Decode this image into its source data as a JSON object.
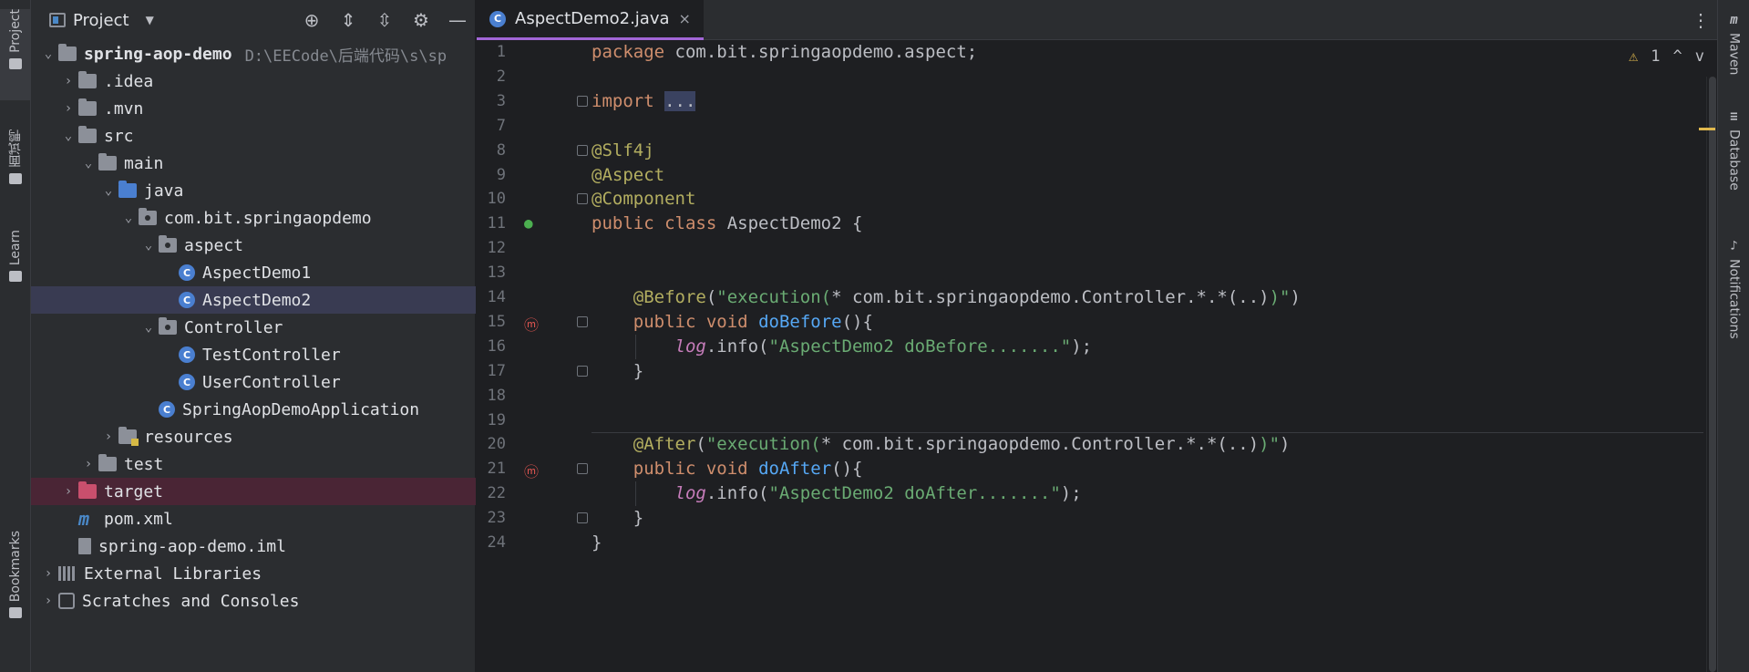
{
  "left_strip": {
    "tabs": [
      {
        "label": "Project",
        "icon": "folder-icon",
        "active": true
      },
      {
        "label": "面试鸭",
        "icon": "duck-icon",
        "active": false
      },
      {
        "label": "Learn",
        "icon": "graduation-cap-icon",
        "active": false
      },
      {
        "label": "Bookmarks",
        "icon": "bookmark-icon",
        "active": false
      }
    ]
  },
  "project_panel": {
    "title": "Project",
    "toolbar_icons": [
      "target-icon",
      "expand-all-icon",
      "collapse-all-icon",
      "gear-icon",
      "minimize-icon"
    ],
    "tree": [
      {
        "label": "spring-aop-demo",
        "path": "D:\\EECode\\后端代码\\s\\sp",
        "depth": 0,
        "expanded": true,
        "icon": "module-folder-icon",
        "bold": true
      },
      {
        "label": ".idea",
        "depth": 1,
        "expanded": false,
        "icon": "folder-icon"
      },
      {
        "label": ".mvn",
        "depth": 1,
        "expanded": false,
        "icon": "folder-icon"
      },
      {
        "label": "src",
        "depth": 1,
        "expanded": true,
        "icon": "folder-icon"
      },
      {
        "label": "main",
        "depth": 2,
        "expanded": true,
        "icon": "folder-icon"
      },
      {
        "label": "java",
        "depth": 3,
        "expanded": true,
        "icon": "source-folder-icon"
      },
      {
        "label": "com.bit.springaopdemo",
        "depth": 4,
        "expanded": true,
        "icon": "package-icon"
      },
      {
        "label": "aspect",
        "depth": 5,
        "expanded": true,
        "icon": "package-icon"
      },
      {
        "label": "AspectDemo1",
        "depth": 6,
        "icon": "class-icon"
      },
      {
        "label": "AspectDemo2",
        "depth": 6,
        "icon": "class-icon",
        "selected": true
      },
      {
        "label": "Controller",
        "depth": 5,
        "expanded": true,
        "icon": "package-icon"
      },
      {
        "label": "TestController",
        "depth": 6,
        "icon": "class-icon"
      },
      {
        "label": "UserController",
        "depth": 6,
        "icon": "class-icon"
      },
      {
        "label": "SpringAopDemoApplication",
        "depth": 5,
        "icon": "spring-boot-class-icon"
      },
      {
        "label": "resources",
        "depth": 3,
        "expanded": false,
        "icon": "resources-folder-icon"
      },
      {
        "label": "test",
        "depth": 2,
        "expanded": false,
        "icon": "folder-icon"
      },
      {
        "label": "target",
        "depth": 1,
        "expanded": false,
        "icon": "excluded-folder-icon",
        "excluded": true
      },
      {
        "label": "pom.xml",
        "depth": 1,
        "icon": "maven-icon"
      },
      {
        "label": "spring-aop-demo.iml",
        "depth": 1,
        "icon": "iml-file-icon"
      },
      {
        "label": "External Libraries",
        "depth": 0,
        "expanded": false,
        "icon": "libraries-icon"
      },
      {
        "label": "Scratches and Consoles",
        "depth": 0,
        "expanded": false,
        "icon": "scratches-icon"
      }
    ]
  },
  "editor": {
    "tab": {
      "title": "AspectDemo2.java",
      "icon": "class-icon",
      "close": "×"
    },
    "more_icon": "⋮",
    "inspections": {
      "warning_count": "1",
      "warning_icon": "warning-icon",
      "up": "^",
      "down": "v"
    },
    "lines": [
      {
        "no": "1",
        "tokens": [
          [
            "kw",
            "package"
          ],
          [
            "",
            " com.bit.springaopdemo.aspect;"
          ]
        ]
      },
      {
        "no": "2",
        "tokens": []
      },
      {
        "no": "3",
        "tokens": [
          [
            "kw",
            "import"
          ],
          [
            "",
            " "
          ],
          [
            "fold-hl",
            "..."
          ]
        ]
      },
      {
        "no": "7",
        "tokens": []
      },
      {
        "no": "8",
        "tokens": [
          [
            "ann",
            "@Slf4j"
          ]
        ]
      },
      {
        "no": "9",
        "tokens": [
          [
            "ann",
            "@Aspect"
          ]
        ]
      },
      {
        "no": "10",
        "tokens": [
          [
            "ann",
            "@Component"
          ]
        ]
      },
      {
        "no": "11",
        "tokens": [
          [
            "kw",
            "public class"
          ],
          [
            "",
            " AspectDemo2 {"
          ]
        ]
      },
      {
        "no": "12",
        "tokens": []
      },
      {
        "no": "13",
        "tokens": []
      },
      {
        "no": "14",
        "tokens": [
          [
            "",
            "    "
          ],
          [
            "ann",
            "@Before"
          ],
          [
            "",
            "("
          ],
          [
            "str",
            "\"execution("
          ],
          [
            "",
            "* com.bit.springaopdemo.Controller.*.*(..)"
          ],
          [
            "str",
            ")\""
          ],
          [
            "",
            ")"
          ]
        ]
      },
      {
        "no": "15",
        "tokens": [
          [
            "",
            "    "
          ],
          [
            "kw",
            "public void"
          ],
          [
            "",
            " "
          ],
          [
            "fn",
            "doBefore"
          ],
          [
            "",
            "(){"
          ]
        ]
      },
      {
        "no": "16",
        "tokens": [
          [
            "",
            "        "
          ],
          [
            "fld",
            "log"
          ],
          [
            "",
            ".info("
          ],
          [
            "str",
            "\"AspectDemo2 doBefore.......\""
          ],
          [
            "",
            ");"
          ]
        ]
      },
      {
        "no": "17",
        "tokens": [
          [
            "",
            "    }"
          ]
        ]
      },
      {
        "no": "18",
        "tokens": []
      },
      {
        "no": "19",
        "tokens": []
      },
      {
        "no": "20",
        "tokens": [
          [
            "",
            "    "
          ],
          [
            "ann",
            "@After"
          ],
          [
            "",
            "("
          ],
          [
            "str",
            "\"execution("
          ],
          [
            "",
            "* com.bit.springaopdemo.Controller.*.*(..)"
          ],
          [
            "str",
            ")\""
          ],
          [
            "",
            ")"
          ]
        ]
      },
      {
        "no": "21",
        "tokens": [
          [
            "",
            "    "
          ],
          [
            "kw",
            "public void"
          ],
          [
            "",
            " "
          ],
          [
            "fn",
            "doAfter"
          ],
          [
            "",
            "(){"
          ]
        ]
      },
      {
        "no": "22",
        "tokens": [
          [
            "",
            "        "
          ],
          [
            "fld",
            "log"
          ],
          [
            "",
            ".info("
          ],
          [
            "str",
            "\"AspectDemo2 doAfter.......\""
          ],
          [
            "",
            ");"
          ]
        ]
      },
      {
        "no": "23",
        "tokens": [
          [
            "",
            "    }"
          ]
        ]
      },
      {
        "no": "24",
        "tokens": [
          [
            "",
            "}"
          ]
        ]
      }
    ]
  },
  "right_strip": {
    "tabs": [
      {
        "label": "Maven",
        "icon": "maven-icon"
      },
      {
        "label": "Database",
        "icon": "database-icon"
      },
      {
        "label": "Notifications",
        "icon": "bell-icon"
      }
    ]
  },
  "colors": {
    "background": "#1e1f22",
    "panel": "#2b2d30",
    "selection": "#393b52",
    "excluded": "#4a2535",
    "tab_underline": "#a266d6",
    "keyword": "#cf8e6d",
    "annotation": "#b3ae60",
    "string": "#6aab73",
    "method": "#56a8f5"
  }
}
